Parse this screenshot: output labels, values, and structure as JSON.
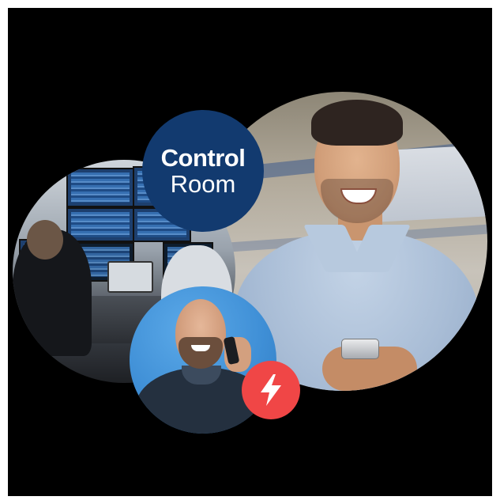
{
  "badge": {
    "line1": "Control",
    "line2": "Room",
    "color": "#123a6f"
  },
  "icons": {
    "bolt": "lightning-bolt-icon",
    "bolt_color": "#f04646"
  },
  "colors": {
    "background": "#000000",
    "phone_photo_backdrop": "#3f8fd6"
  }
}
